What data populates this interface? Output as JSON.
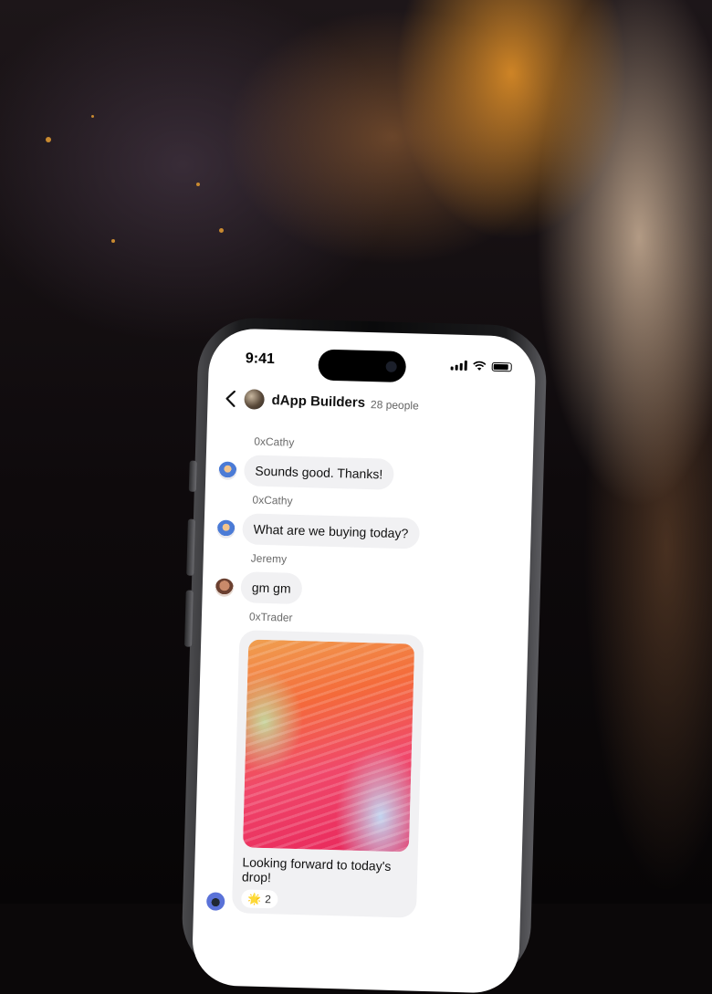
{
  "status_bar": {
    "time": "9:41"
  },
  "header": {
    "group_name": "dApp Builders",
    "member_count": "28 people"
  },
  "messages": [
    {
      "sender": "0xCathy",
      "text": "Sounds good. Thanks!"
    },
    {
      "sender": "0xCathy",
      "text": "What are we buying today?"
    },
    {
      "sender": "Jeremy",
      "text": "gm gm"
    },
    {
      "sender": "0xTrader",
      "caption": "Looking forward to today's drop!",
      "reaction_emoji": "🌟",
      "reaction_count": "2"
    }
  ],
  "icons": [
    "back-chevron-icon",
    "group-avatar",
    "signal-icon",
    "wifi-icon",
    "battery-icon"
  ]
}
